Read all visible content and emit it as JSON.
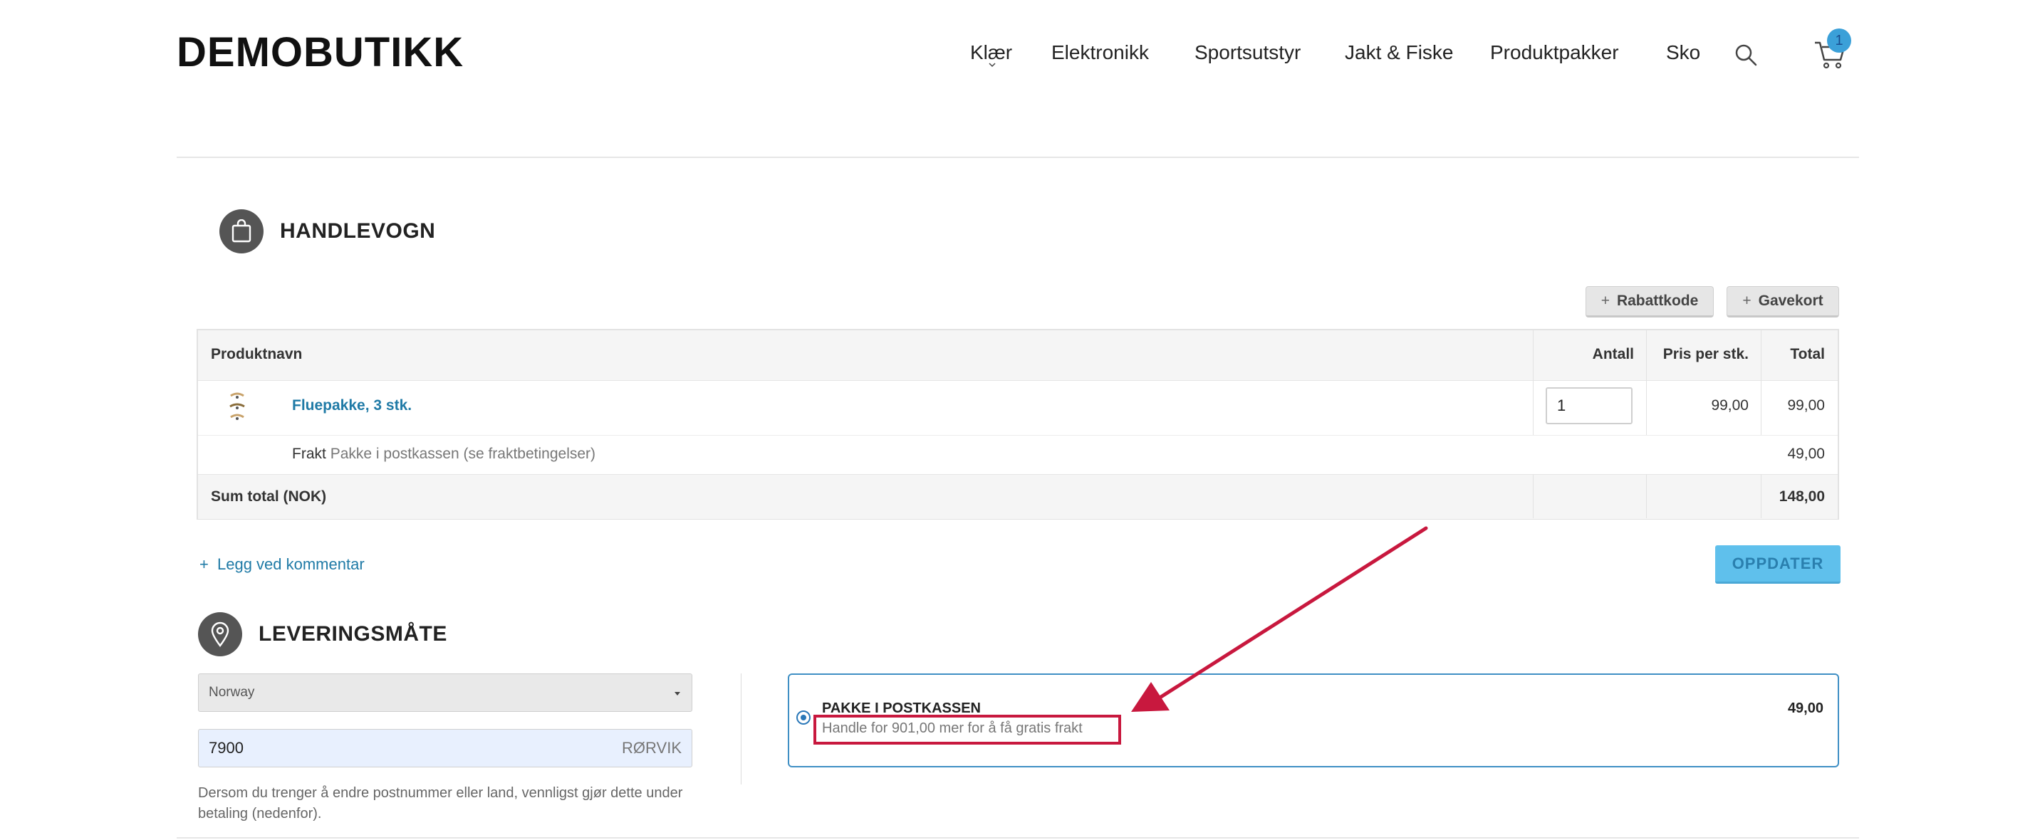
{
  "header": {
    "logo": "DEMOBUTIKK",
    "nav": [
      "Klær",
      "Elektronikk",
      "Sportsutstyr",
      "Jakt & Fiske",
      "Produktpakker",
      "Sko"
    ],
    "cart_count": "1"
  },
  "cart": {
    "title": "HANDLEVOGN",
    "buttons": {
      "discount": "Rabattkode",
      "giftcard": "Gavekort",
      "plus": "+"
    },
    "columns": {
      "product": "Produktnavn",
      "quantity": "Antall",
      "unit_price": "Pris per stk.",
      "total": "Total"
    },
    "item": {
      "name": "Fluepakke, 3 stk.",
      "quantity": "1",
      "unit_price": "99,00",
      "total": "99,00"
    },
    "shipping": {
      "label": "Frakt",
      "description": "Pakke i postkassen (se fraktbetingelser)",
      "total": "49,00"
    },
    "sum": {
      "label": "Sum total (NOK)",
      "total": "148,00"
    },
    "comment_link": "Legg ved kommentar",
    "update_button": "OPPDATER"
  },
  "delivery": {
    "title": "LEVERINGSMÅTE",
    "country": "Norway",
    "postal_code": "7900",
    "city": "RØRVIK",
    "help_text": "Dersom du trenger å endre postnummer eller land, vennligst gjør dette under betaling (nedenfor).",
    "option": {
      "name": "PAKKE I POSTKASSEN",
      "note": "Handle for 901,00 mer for å få gratis frakt",
      "price": "49,00"
    }
  },
  "colors": {
    "accent": "#1f7aa6",
    "button_blue": "#5fc0ec",
    "annotation_red": "#c8183e",
    "badge": "#3ba0d8"
  }
}
